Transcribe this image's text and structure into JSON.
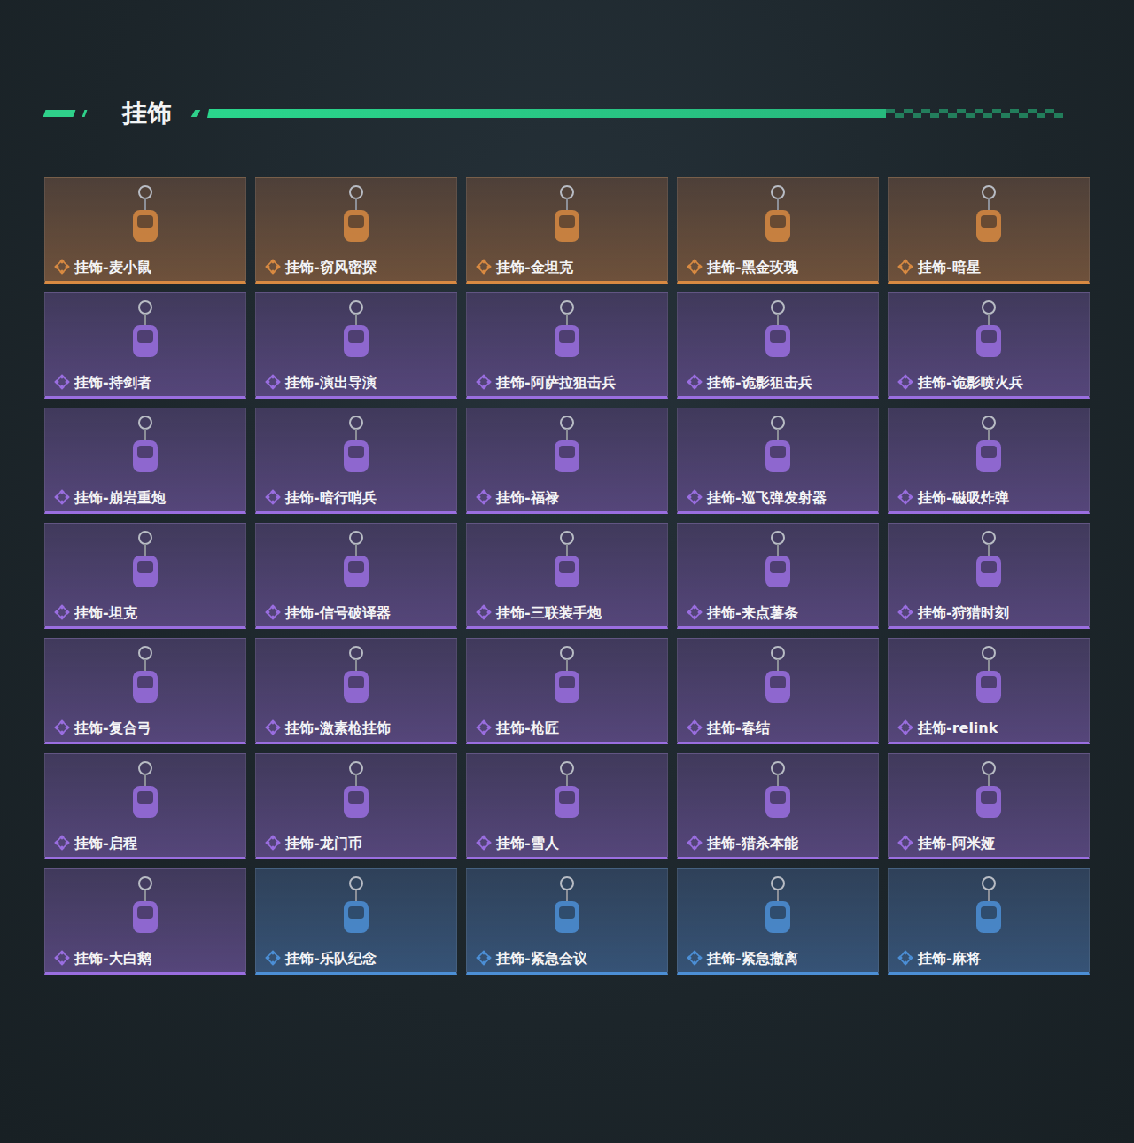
{
  "section": {
    "title": "挂饰"
  },
  "items": [
    {
      "name": "挂饰-麦小鼠",
      "rarity": "orange",
      "color": "#d88a42"
    },
    {
      "name": "挂饰-窃风密探",
      "rarity": "orange",
      "color": "#d88a42"
    },
    {
      "name": "挂饰-金坦克",
      "rarity": "orange",
      "color": "#d88a42"
    },
    {
      "name": "挂饰-黑金玫瑰",
      "rarity": "orange",
      "color": "#d88a42"
    },
    {
      "name": "挂饰-暗星",
      "rarity": "orange",
      "color": "#d88a42"
    },
    {
      "name": "挂饰-持剑者",
      "rarity": "purple",
      "color": "#9a6ee0"
    },
    {
      "name": "挂饰-演出导演",
      "rarity": "purple",
      "color": "#9a6ee0"
    },
    {
      "name": "挂饰-阿萨拉狙击兵",
      "rarity": "purple",
      "color": "#9a6ee0"
    },
    {
      "name": "挂饰-诡影狙击兵",
      "rarity": "purple",
      "color": "#9a6ee0"
    },
    {
      "name": "挂饰-诡影喷火兵",
      "rarity": "purple",
      "color": "#9a6ee0"
    },
    {
      "name": "挂饰-崩岩重炮",
      "rarity": "purple",
      "color": "#9a6ee0"
    },
    {
      "name": "挂饰-暗行哨兵",
      "rarity": "purple",
      "color": "#9a6ee0"
    },
    {
      "name": "挂饰-福禄",
      "rarity": "purple",
      "color": "#9a6ee0"
    },
    {
      "name": "挂饰-巡飞弹发射器",
      "rarity": "purple",
      "color": "#9a6ee0"
    },
    {
      "name": "挂饰-磁吸炸弹",
      "rarity": "purple",
      "color": "#9a6ee0"
    },
    {
      "name": "挂饰-坦克",
      "rarity": "purple",
      "color": "#9a6ee0"
    },
    {
      "name": "挂饰-信号破译器",
      "rarity": "purple",
      "color": "#9a6ee0"
    },
    {
      "name": "挂饰-三联装手炮",
      "rarity": "purple",
      "color": "#9a6ee0"
    },
    {
      "name": "挂饰-来点薯条",
      "rarity": "purple",
      "color": "#9a6ee0"
    },
    {
      "name": "挂饰-狩猎时刻",
      "rarity": "purple",
      "color": "#9a6ee0"
    },
    {
      "name": "挂饰-复合弓",
      "rarity": "purple",
      "color": "#9a6ee0"
    },
    {
      "name": "挂饰-激素枪挂饰",
      "rarity": "purple",
      "color": "#9a6ee0"
    },
    {
      "name": "挂饰-枪匠",
      "rarity": "purple",
      "color": "#9a6ee0"
    },
    {
      "name": "挂饰-春结",
      "rarity": "purple",
      "color": "#9a6ee0"
    },
    {
      "name": "挂饰-relink",
      "rarity": "purple",
      "color": "#9a6ee0"
    },
    {
      "name": "挂饰-启程",
      "rarity": "purple",
      "color": "#9a6ee0"
    },
    {
      "name": "挂饰-龙门币",
      "rarity": "purple",
      "color": "#9a6ee0"
    },
    {
      "name": "挂饰-雪人",
      "rarity": "purple",
      "color": "#9a6ee0"
    },
    {
      "name": "挂饰-猎杀本能",
      "rarity": "purple",
      "color": "#9a6ee0"
    },
    {
      "name": "挂饰-阿米娅",
      "rarity": "purple",
      "color": "#9a6ee0"
    },
    {
      "name": "挂饰-大白鹅",
      "rarity": "purple",
      "color": "#9a6ee0"
    },
    {
      "name": "挂饰-乐队纪念",
      "rarity": "blue",
      "color": "#4c8fd6"
    },
    {
      "name": "挂饰-紧急会议",
      "rarity": "blue",
      "color": "#4c8fd6"
    },
    {
      "name": "挂饰-紧急撤离",
      "rarity": "blue",
      "color": "#4c8fd6"
    },
    {
      "name": "挂饰-麻将",
      "rarity": "blue",
      "color": "#4c8fd6"
    }
  ]
}
